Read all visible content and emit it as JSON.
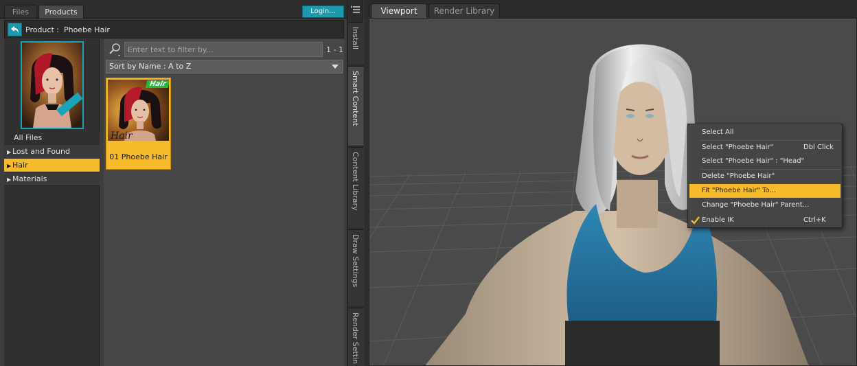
{
  "content_pane": {
    "tabs": [
      {
        "label": "Files",
        "active": false
      },
      {
        "label": "Products",
        "active": true
      }
    ],
    "login_label": "Login...",
    "breadcrumb": "Product :  Phoebe Hair",
    "categories": [
      {
        "label": "All Files",
        "expandable": false,
        "selected": false
      },
      {
        "label": "Lost and Found",
        "expandable": true,
        "selected": false
      },
      {
        "label": "Hair",
        "expandable": true,
        "selected": true
      },
      {
        "label": "Materials",
        "expandable": true,
        "selected": false
      }
    ],
    "search": {
      "placeholder": "Enter text to filter by...",
      "value": ""
    },
    "result_count": "1 - 1",
    "sort": {
      "selected": "Sort by Name : A to Z"
    },
    "items": [
      {
        "label": "01 Phoebe Hair",
        "badge": "Hair",
        "thumb_caption": "Hair"
      }
    ]
  },
  "side_tabs": [
    "Install",
    "Smart Content",
    "Content Library",
    "Draw Settings",
    "Render Settin"
  ],
  "viewport": {
    "tabs": [
      {
        "label": "Viewport",
        "active": true
      },
      {
        "label": "Render Library",
        "active": false
      }
    ]
  },
  "context_menu": {
    "items": [
      {
        "label": "Select All",
        "shortcut": ""
      },
      {
        "label": "Select \"Phoebe Hair\"",
        "shortcut": "Dbl Click"
      },
      {
        "label": "Select \"Phoebe Hair\" : \"Head\"",
        "shortcut": ""
      },
      {
        "label": "Delete \"Phoebe Hair\"",
        "shortcut": ""
      },
      {
        "label": "Fit \"Phoebe Hair\" To...",
        "shortcut": "",
        "highlighted": true
      },
      {
        "label": "Change \"Phoebe Hair\" Parent...",
        "shortcut": ""
      },
      {
        "label": "Enable IK",
        "shortcut": "Ctrl+K",
        "checked": true
      }
    ]
  },
  "colors": {
    "accent_teal": "#1d98ad",
    "selection_yellow": "#f5bb2a",
    "badge_green": "#22b83a"
  }
}
